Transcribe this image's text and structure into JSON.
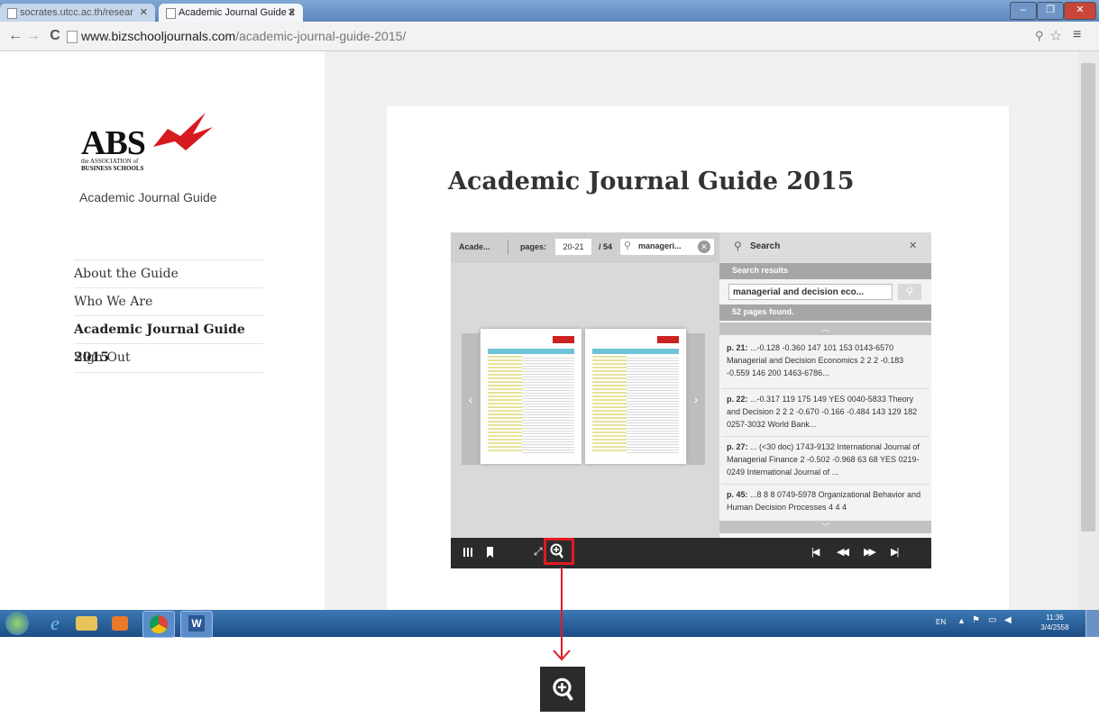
{
  "browser": {
    "tabs": [
      {
        "title": "socrates.utcc.ac.th/resear"
      },
      {
        "title": "Academic Journal Guide 2"
      }
    ],
    "url_domain": "www.bizschooljournals.com",
    "url_path": "/academic-journal-guide-2015/"
  },
  "sidebar": {
    "logo_main": "ABS",
    "logo_line1": "the ASSOCIATION of",
    "logo_line2": "BUSINESS SCHOOLS",
    "site_title": "Academic Journal Guide",
    "nav": [
      {
        "label": "About the Guide"
      },
      {
        "label": "Who We Are"
      },
      {
        "label": "Academic Journal Guide 2015",
        "active": true
      },
      {
        "label": "Sign Out"
      }
    ]
  },
  "main": {
    "title": "Academic Journal Guide 2015"
  },
  "viewer": {
    "doc_short": "Acade...",
    "pages_label": "pages:",
    "pages_value": "20-21",
    "pages_total": "/ 54",
    "search_chip": "manageri...",
    "search_panel_title": "Search",
    "search_results_heading": "Search results",
    "search_query": "managerial and decision eco...",
    "found_text": "52 pages found.",
    "results": [
      {
        "page": "p. 21:",
        "text": "...-0.128 -0.360 147 101 153 0143-6570 Managerial and Decision Economics 2 2 2 -0.183 -0.559 146 200 1463-6786..."
      },
      {
        "page": "p. 22:",
        "text": "...-0.317 119 175 149 YES 0040-5833 Theory and Decision 2 2 2 -0.670 -0.166 -0.484 143 129 182 0257-3032 World Bank..."
      },
      {
        "page": "p. 27:",
        "text": "... (<30 doc) 1743-9132 International Journal of Managerial Finance 2 -0.502 -0.968 63 68 YES 0219-0249 International Journal of ..."
      },
      {
        "page": "p. 45:",
        "text": "...8 8 8 0749-5978 Organizational Behavior and Human Decision Processes 4 4 4"
      }
    ]
  },
  "taskbar": {
    "lang": "EN",
    "time": "11:36",
    "date": "3/4/2558"
  },
  "colors": {
    "highlight_box": "#e11b22",
    "arrow": "#e11b22",
    "viewer_bar": "#2b2b2b",
    "logo_red": "#d71920"
  }
}
